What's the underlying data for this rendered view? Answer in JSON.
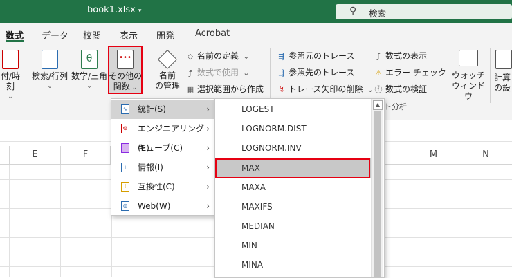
{
  "window": {
    "title": "book1.xlsx",
    "title_caret": "▾",
    "search_placeholder": "検索"
  },
  "tabs": [
    "数式",
    "データ",
    "校閲",
    "表示",
    "開発",
    "Acrobat"
  ],
  "ribbon": {
    "date_time": "付/時刻",
    "lookup": "検索/行列",
    "math": "数学/三角",
    "more_functions": [
      "その他の",
      "関数"
    ],
    "name_manager": [
      "名前",
      "の管理"
    ],
    "define_name": "名前の定義",
    "use_in_formula": "数式で使用",
    "create_from_selection": "選択範囲から作成",
    "trace_precedents": "参照元のトレース",
    "trace_dependents": "参照先のトレース",
    "remove_arrows": "トレース矢印の削除",
    "show_formulas": "数式の表示",
    "error_checking": "エラー チェック",
    "evaluate_formula": "数式の検証",
    "watch_window": [
      "ウォッチ",
      "ウィンドウ"
    ],
    "calc_options": [
      "計算",
      "の設"
    ],
    "group_formula_auditing": "ト分析"
  },
  "columns": [
    "E",
    "F",
    "M",
    "N"
  ],
  "menu": {
    "items": [
      {
        "label": "統計(S)",
        "icon": "stats-icon"
      },
      {
        "label": "エンジニアリング(E)",
        "icon": "engineering-icon"
      },
      {
        "label": "キューブ(C)",
        "icon": "cube-icon"
      },
      {
        "label": "情報(I)",
        "icon": "info-icon"
      },
      {
        "label": "互換性(C)",
        "icon": "compatibility-icon"
      },
      {
        "label": "Web(W)",
        "icon": "web-icon"
      }
    ]
  },
  "submenu": {
    "items": [
      "LOGEST",
      "LOGNORM.DIST",
      "LOGNORM.INV",
      "MAX",
      "MAXA",
      "MAXIFS",
      "MEDIAN",
      "MIN",
      "MINA"
    ],
    "selected": "MAX"
  },
  "colors": {
    "accent": "#217346",
    "highlight": "#e60012"
  }
}
